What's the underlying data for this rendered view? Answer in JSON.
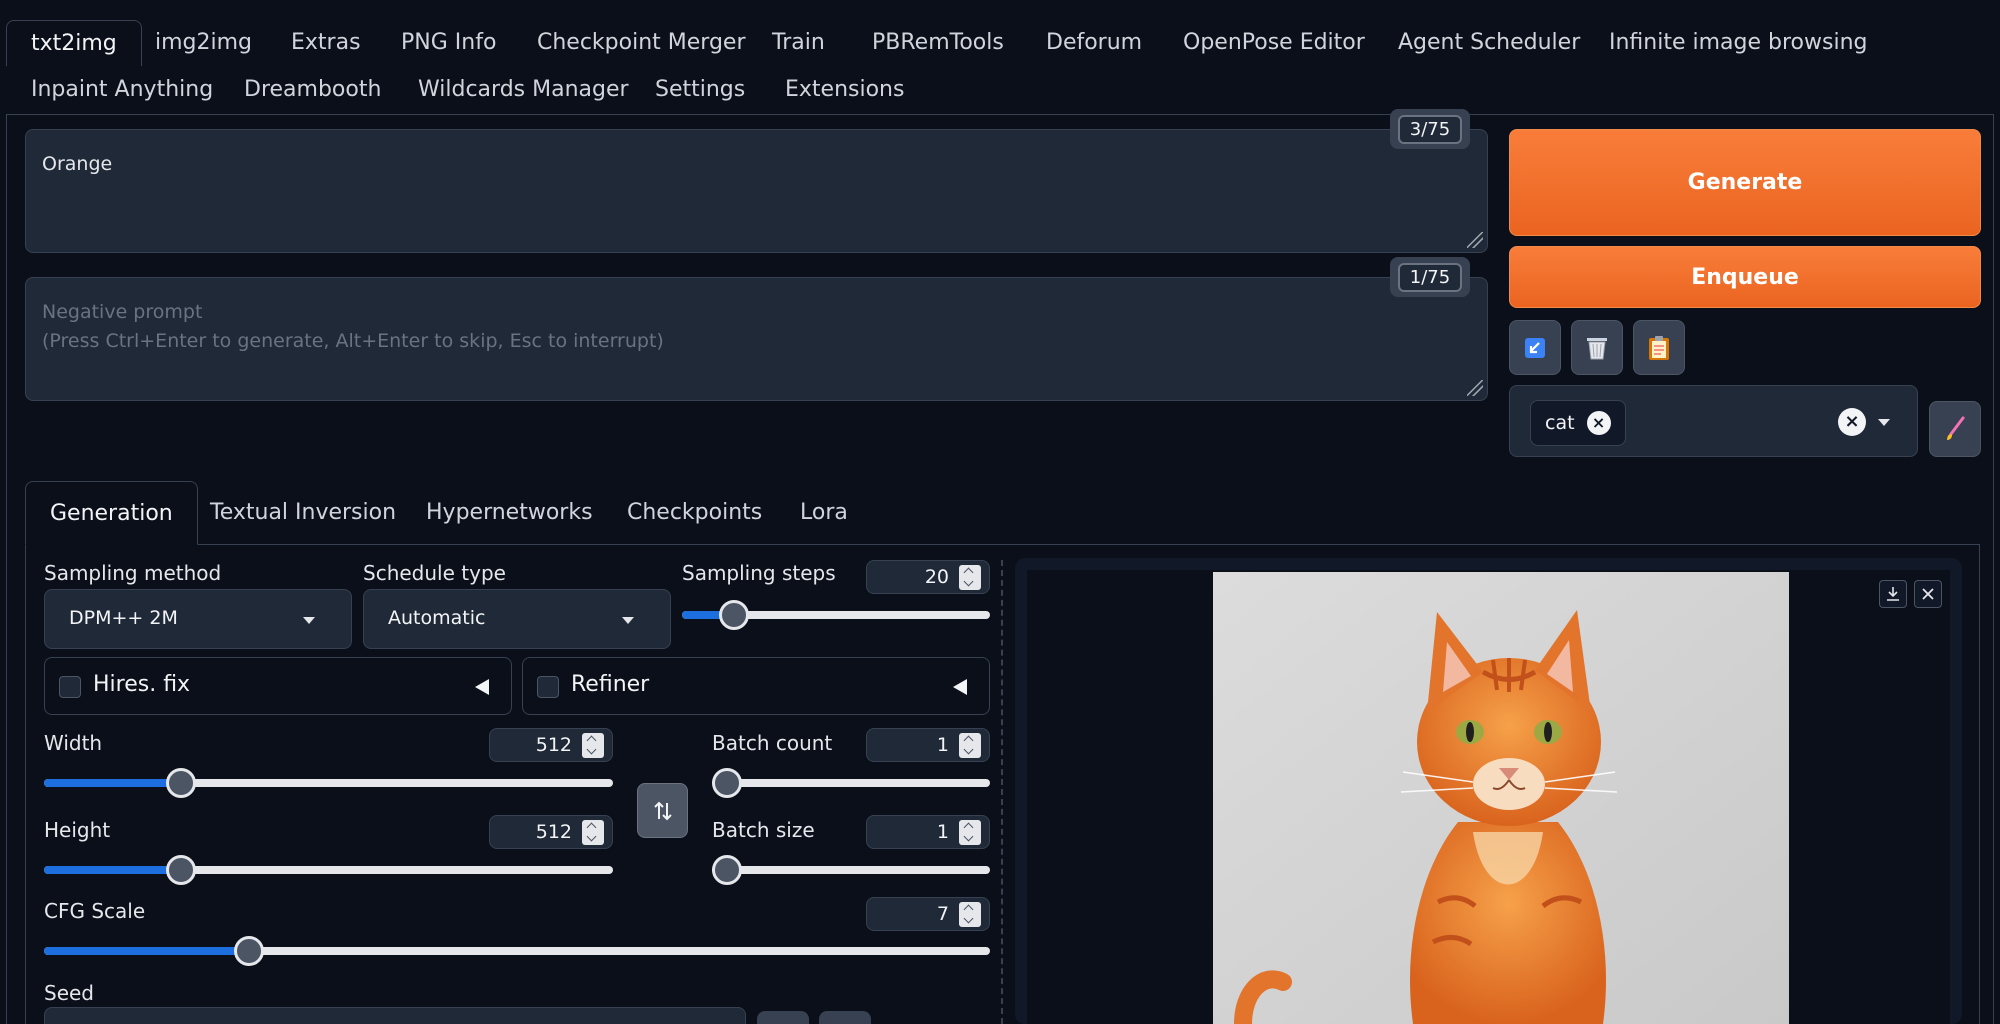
{
  "top_tabs": [
    {
      "label": "txt2img",
      "active": true
    },
    {
      "label": "img2img"
    },
    {
      "label": "Extras"
    },
    {
      "label": "PNG Info"
    },
    {
      "label": "Checkpoint Merger"
    },
    {
      "label": "Train"
    },
    {
      "label": "PBRemTools"
    },
    {
      "label": "Deforum"
    },
    {
      "label": "OpenPose Editor"
    },
    {
      "label": "Agent Scheduler"
    },
    {
      "label": "Infinite image browsing"
    },
    {
      "label": "Inpaint Anything"
    },
    {
      "label": "Dreambooth"
    },
    {
      "label": "Wildcards Manager"
    },
    {
      "label": "Settings"
    },
    {
      "label": "Extensions"
    }
  ],
  "prompt": {
    "value": "Orange",
    "token_count": "3/75"
  },
  "negative_prompt": {
    "placeholder": "Negative prompt\n(Press Ctrl+Enter to generate, Alt+Enter to skip, Esc to interrupt)",
    "token_count": "1/75"
  },
  "actions": {
    "generate_label": "Generate",
    "enqueue_label": "Enqueue",
    "tools": [
      "paste-arrow-icon",
      "trash-icon",
      "clipboard-icon"
    ],
    "styles": {
      "selected_chip": "cat"
    }
  },
  "sub_tabs": [
    {
      "label": "Generation",
      "active": true
    },
    {
      "label": "Textual Inversion"
    },
    {
      "label": "Hypernetworks"
    },
    {
      "label": "Checkpoints"
    },
    {
      "label": "Lora"
    }
  ],
  "generation": {
    "sampling_method": {
      "label": "Sampling method",
      "value": "DPM++ 2M"
    },
    "schedule_type": {
      "label": "Schedule type",
      "value": "Automatic"
    },
    "sampling_steps": {
      "label": "Sampling steps",
      "value": "20",
      "level": 0.17
    },
    "hires_fix": {
      "label": "Hires. fix",
      "checked": false
    },
    "refiner": {
      "label": "Refiner",
      "checked": false
    },
    "width": {
      "label": "Width",
      "value": "512",
      "level": 0.24
    },
    "height": {
      "label": "Height",
      "value": "512",
      "level": 0.24
    },
    "batch_count": {
      "label": "Batch count",
      "value": "1",
      "level": 0.0
    },
    "batch_size": {
      "label": "Batch size",
      "value": "1",
      "level": 0.0
    },
    "cfg_scale": {
      "label": "CFG Scale",
      "value": "7",
      "level": 0.217
    },
    "seed": {
      "label": "Seed"
    }
  },
  "colors": {
    "background": "#0b0f19",
    "accent_orange": "#f97d3a",
    "slider_fill": "#1d6fe0"
  }
}
